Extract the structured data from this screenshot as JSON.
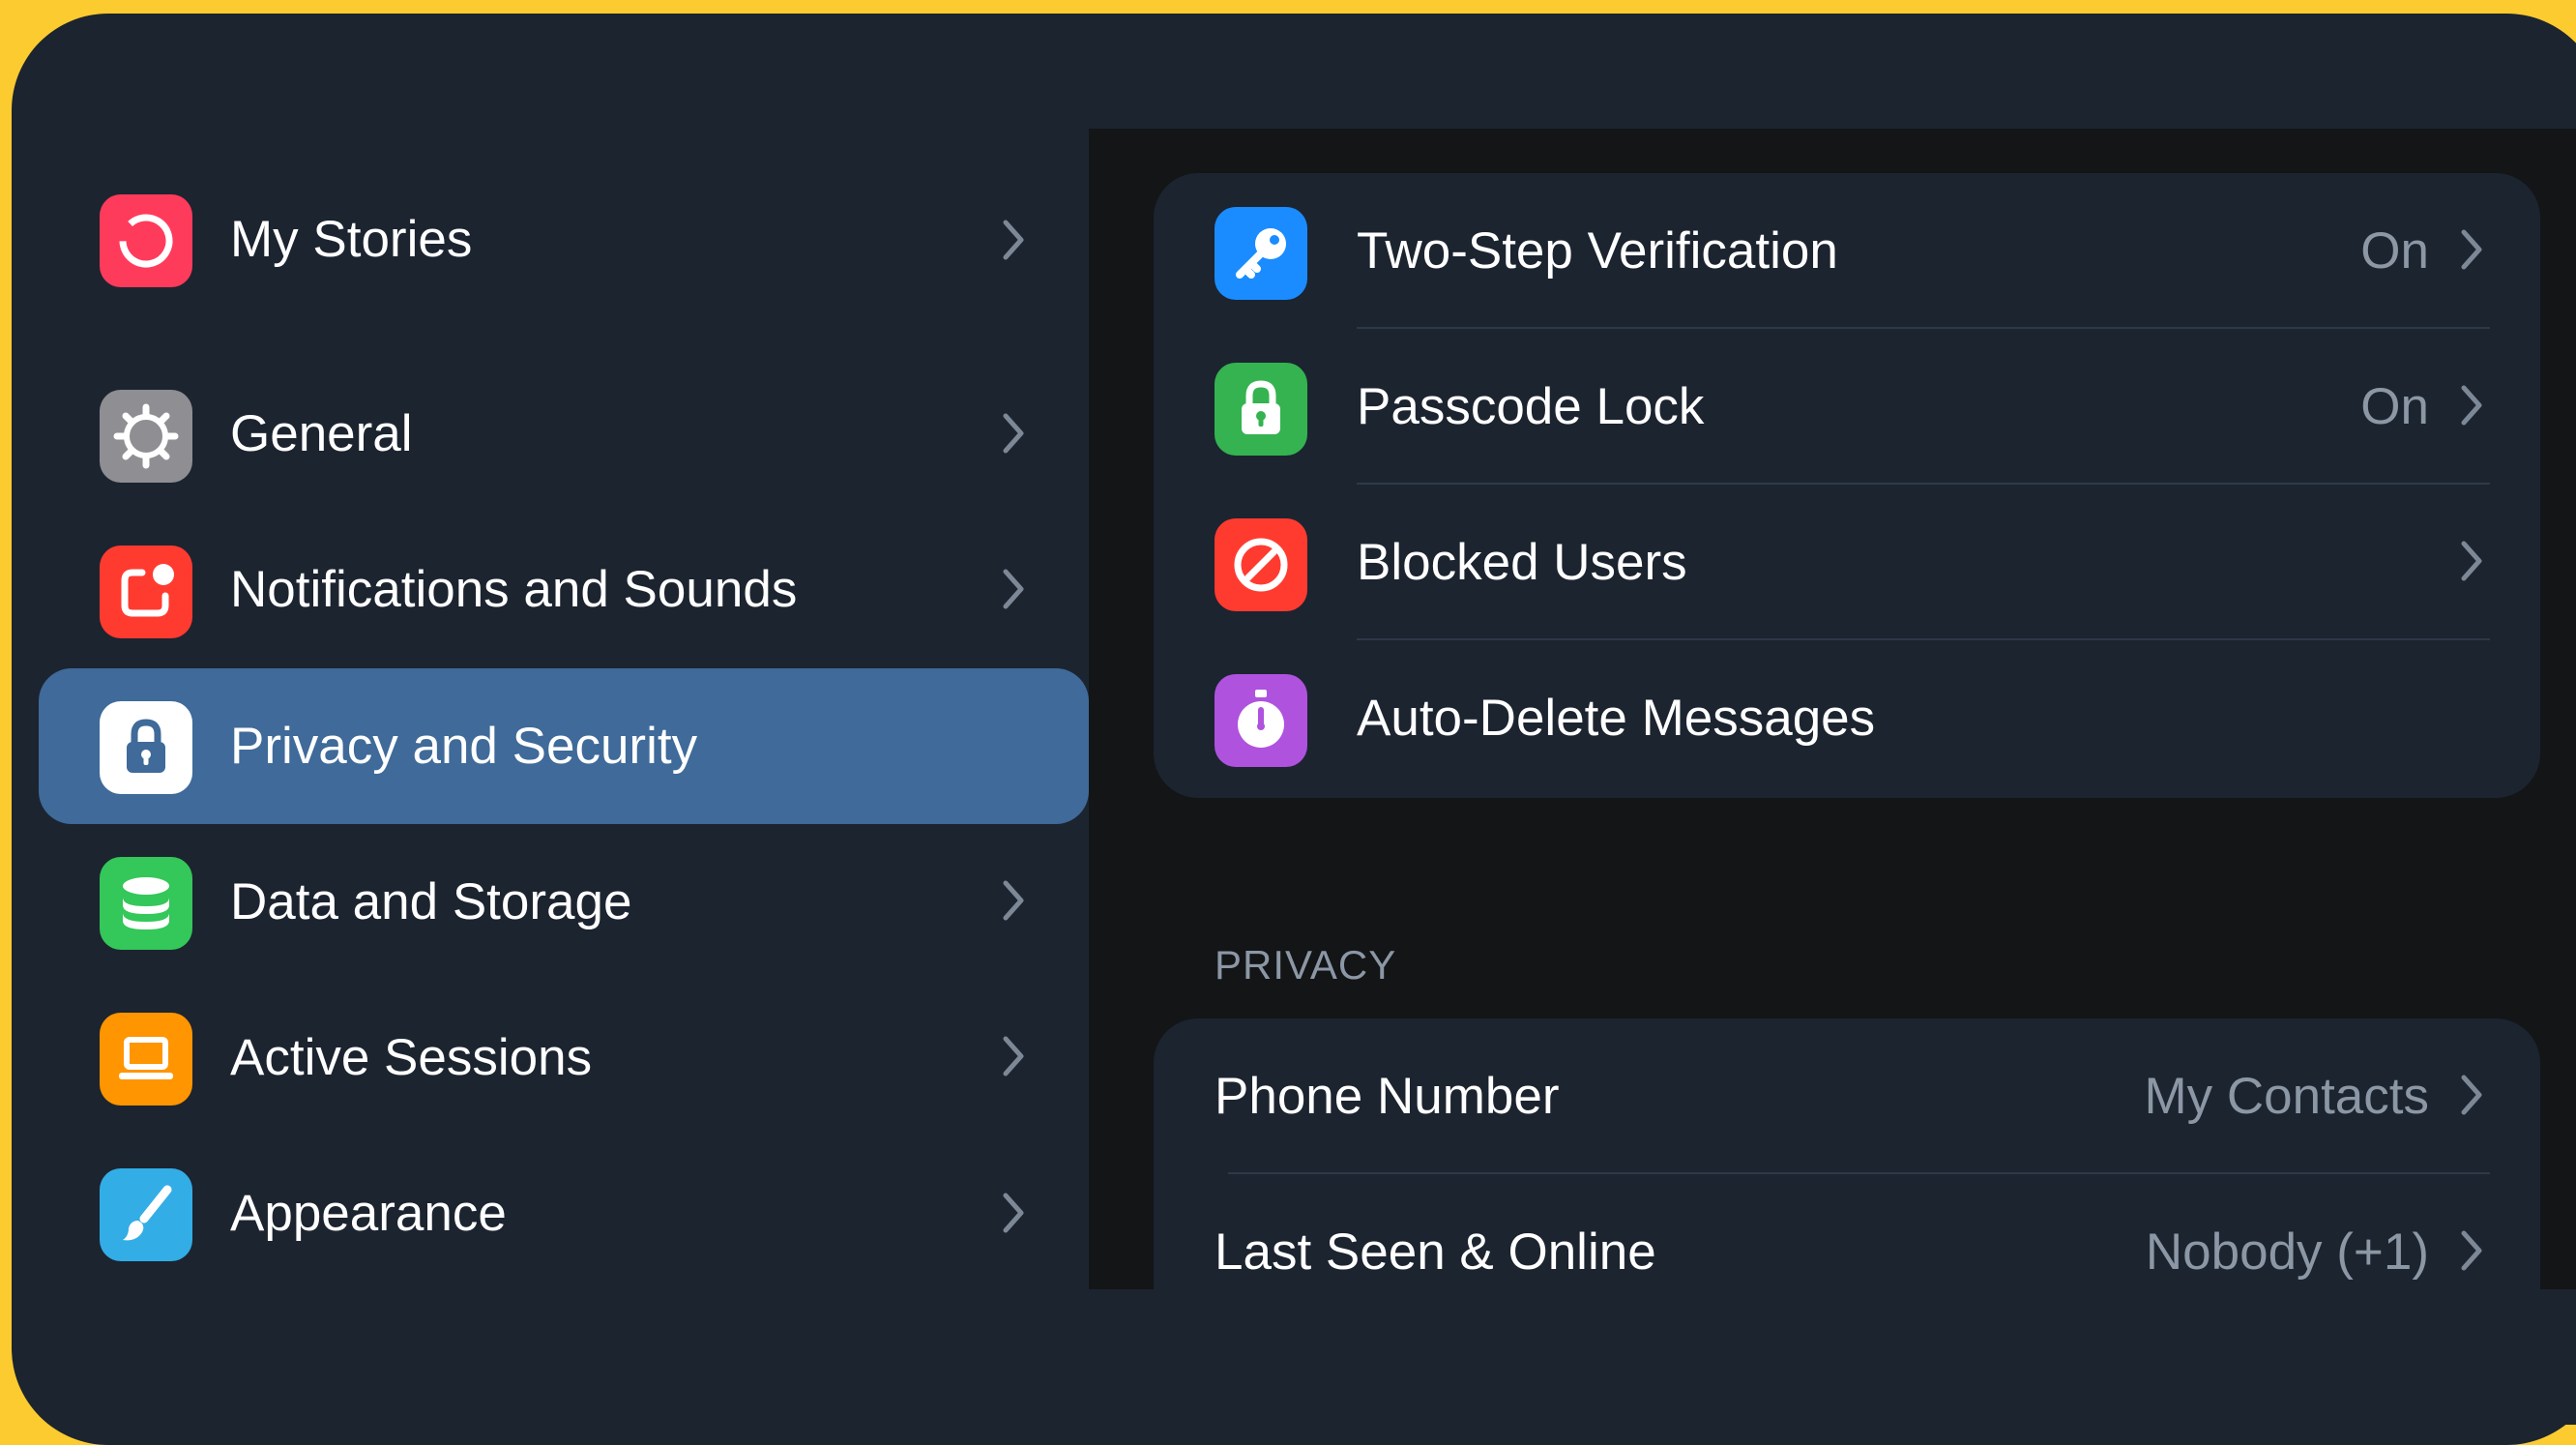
{
  "sidebar": {
    "items": [
      {
        "label": "My Stories",
        "icon": "stories-icon",
        "color": "#ff3b5c"
      },
      {
        "label": "General",
        "icon": "gear-icon",
        "color": "#8e8e93"
      },
      {
        "label": "Notifications and Sounds",
        "icon": "notification-icon",
        "color": "#ff3b30"
      },
      {
        "label": "Privacy and Security",
        "icon": "lock-icon",
        "color": "#ffffff",
        "selected": true
      },
      {
        "label": "Data and Storage",
        "icon": "database-icon",
        "color": "#34c759"
      },
      {
        "label": "Active Sessions",
        "icon": "laptop-icon",
        "color": "#ff9500"
      },
      {
        "label": "Appearance",
        "icon": "brush-icon",
        "color": "#32ade6"
      }
    ],
    "selected_color": "#3f6a99"
  },
  "security": {
    "rows": [
      {
        "label": "Two-Step Verification",
        "value": "On",
        "icon": "key-icon",
        "color": "#1a8cff"
      },
      {
        "label": "Passcode Lock",
        "value": "On",
        "icon": "lock-icon",
        "color": "#34b350"
      },
      {
        "label": "Blocked Users",
        "value": "",
        "icon": "blocked-icon",
        "color": "#ff3b30"
      },
      {
        "label": "Auto-Delete Messages",
        "value": "",
        "icon": "timer-icon",
        "color": "#af52de"
      }
    ]
  },
  "privacy": {
    "header": "PRIVACY",
    "rows": [
      {
        "label": "Phone Number",
        "value": "My Contacts"
      },
      {
        "label": "Last Seen & Online",
        "value": "Nobody (+1)"
      }
    ]
  }
}
